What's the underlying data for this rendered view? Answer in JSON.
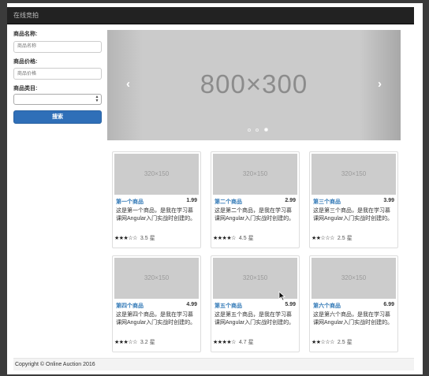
{
  "navbar": {
    "brand": "在线竞拍"
  },
  "search": {
    "name_label": "商品名称:",
    "name_placeholder": "商品名称",
    "price_label": "商品价格:",
    "price_placeholder": "商品价格",
    "category_label": "商品类目:",
    "category_value": "",
    "submit_label": "搜索"
  },
  "carousel": {
    "image_text": "800×300",
    "prev_icon": "chevron-left-icon",
    "next_icon": "chevron-right-icon",
    "slide_count": 3,
    "active_slide": 3
  },
  "products": [
    {
      "image_text": "320×150",
      "name": "第一个商品",
      "price": "1.99",
      "desc": "这是第一个商品，是我在学习慕课网Angular入门实战时创建的。",
      "stars": "★★★☆☆",
      "rating_text": "3.5 星"
    },
    {
      "image_text": "320×150",
      "name": "第二个商品",
      "price": "2.99",
      "desc": "这是第二个商品，是我在学习慕课网Angular入门实战时创建的。",
      "stars": "★★★★☆",
      "rating_text": "4.5 星"
    },
    {
      "image_text": "320×150",
      "name": "第三个商品",
      "price": "3.99",
      "desc": "这是第三个商品，是我在学习慕课网Angular入门实战时创建的。",
      "stars": "★★☆☆☆",
      "rating_text": "2.5 星"
    },
    {
      "image_text": "320×150",
      "name": "第四个商品",
      "price": "4.99",
      "desc": "这是第四个商品，是我在学习慕课网Angular入门实战时创建的。",
      "stars": "★★★☆☆",
      "rating_text": "3.2 星"
    },
    {
      "image_text": "320×150",
      "name": "第五个商品",
      "price": "5.99",
      "desc": "这是第五个商品，是我在学习慕课网Angular入门实战时创建的。",
      "stars": "★★★★☆",
      "rating_text": "4.7 星"
    },
    {
      "image_text": "320×150",
      "name": "第六个商品",
      "price": "6.99",
      "desc": "这是第六个商品，是我在学习慕课网Angular入门实战时创建的。",
      "stars": "★★☆☆☆",
      "rating_text": "2.5 星"
    }
  ],
  "footer": {
    "text": "Copyright © Online Auction 2016"
  },
  "colors": {
    "navbar": "#222222",
    "primary": "#2f6fb8",
    "link": "#337ab7",
    "placeholder": "#cccccc"
  }
}
